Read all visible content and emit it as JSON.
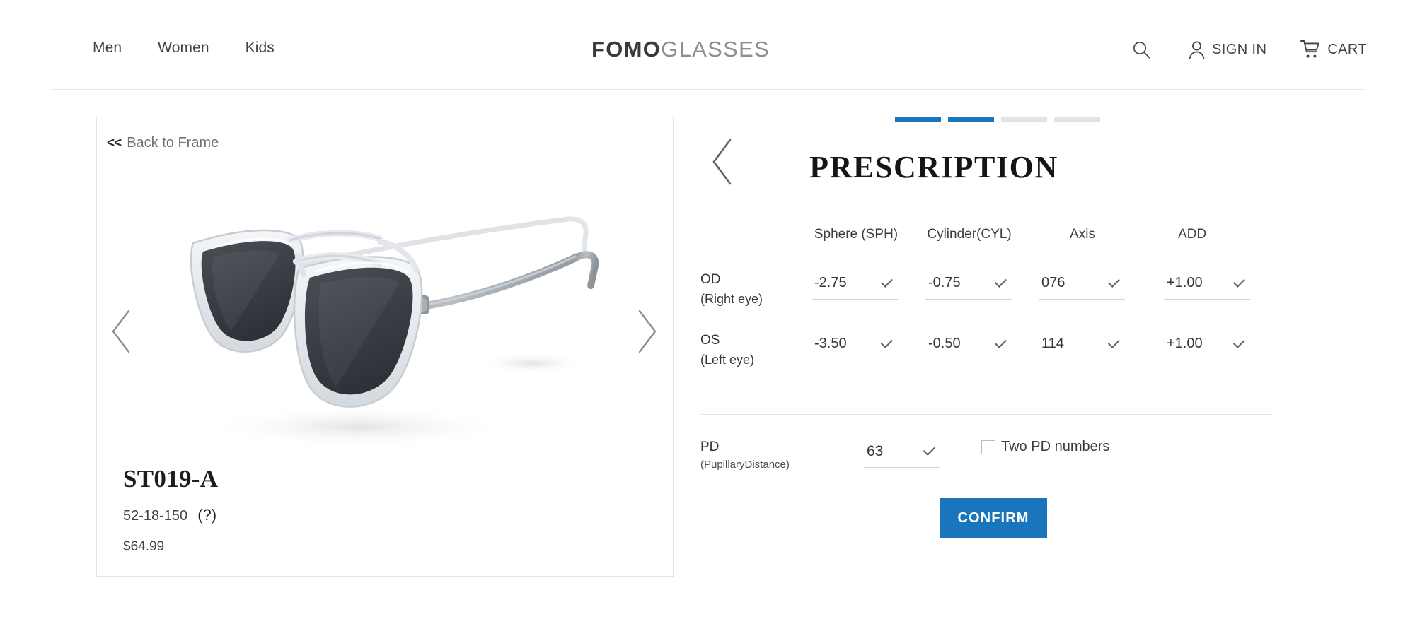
{
  "header": {
    "nav": [
      {
        "label": "Men"
      },
      {
        "label": "Women"
      },
      {
        "label": "Kids"
      }
    ],
    "logo": {
      "bold": "FOMO",
      "light": "GLASSES"
    },
    "actions": {
      "search_icon": "search-icon",
      "account_icon": "person-icon",
      "account_label": "SIGN IN",
      "cart_icon": "cart-icon",
      "cart_label": "CART"
    }
  },
  "product": {
    "back_chevrons": "<<",
    "back_label": "Back to Frame",
    "prev_icon": "chevron-left-icon",
    "next_icon": "chevron-right-icon",
    "name": "ST019-A",
    "dimensions": "52-18-150",
    "help_label": "(?)",
    "price": "$64.99"
  },
  "prescription": {
    "steps": [
      {
        "state": "active"
      },
      {
        "state": "active"
      },
      {
        "state": "inactive"
      },
      {
        "state": "inactive"
      }
    ],
    "back_icon": "chevron-left-icon",
    "title": "PRESCRIPTION",
    "columns": [
      {
        "key": "sph",
        "label": "Sphere (SPH)"
      },
      {
        "key": "cyl",
        "label": "Cylinder(CYL)"
      },
      {
        "key": "axis",
        "label": "Axis"
      },
      {
        "key": "add",
        "label": "ADD"
      }
    ],
    "rows": [
      {
        "eye_code": "OD",
        "eye_desc": "(Right eye)",
        "sph": "-2.75",
        "cyl": "-0.75",
        "axis": "076",
        "add": "+1.00"
      },
      {
        "eye_code": "OS",
        "eye_desc": "(Left eye)",
        "sph": "-3.50",
        "cyl": "-0.50",
        "axis": "114",
        "add": "+1.00"
      }
    ],
    "pd": {
      "label": "PD",
      "sub_label": "(PupillaryDistance)",
      "value": "63",
      "two_pd_label": "Two PD numbers",
      "two_pd_checked": false
    },
    "confirm_label": "CONFIRM"
  },
  "colors": {
    "accent_blue": "#1a76bc",
    "step_inactive": "#e3e3e3",
    "text_dark": "#33373c",
    "lens_dark": "#3b3f45"
  }
}
